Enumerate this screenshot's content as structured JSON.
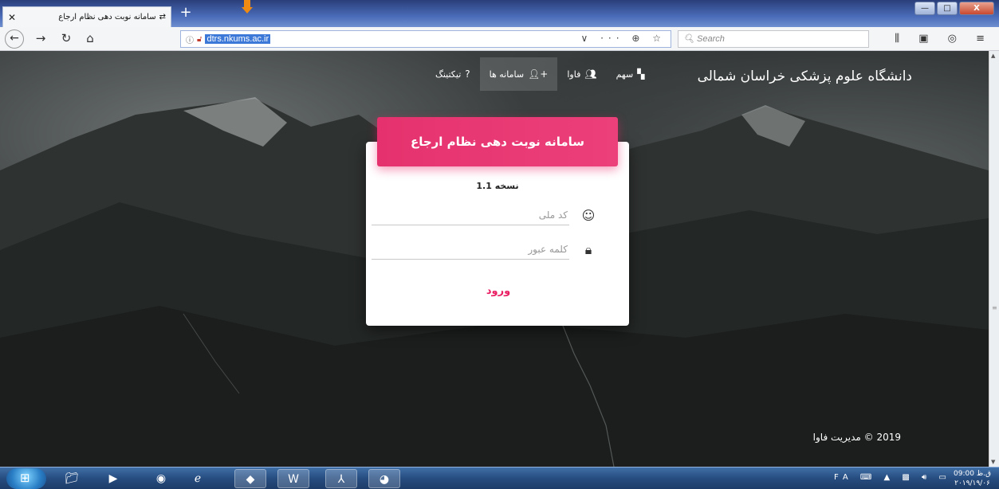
{
  "browser": {
    "tab_title": "سامانه نوبت دهی نظام ارجاع",
    "tab_favicon": "⇄",
    "tab_close": "✕",
    "new_tab": "+",
    "url": "dtrs.nkums.ac.ir",
    "url_info_icon": "ⓘ",
    "url_lock_icon": "🔓︎",
    "url_actions": "∨ ··· ⊕ ☆",
    "search_placeholder": "Search",
    "toolbar_icons": "⫼ ▣ ◎ ≡",
    "window_buttons": {
      "minimize": "—",
      "maximize": "□",
      "close": "X"
    }
  },
  "site": {
    "title": "دانشگاه علوم پزشکی خراسان شمالی",
    "nav": [
      {
        "label": "سهم",
        "icon": "▚"
      },
      {
        "label": "فاوا",
        "icon": "👥︎"
      },
      {
        "label": "سامانه ها",
        "icon": "+👤︎"
      },
      {
        "label": "تیکتینگ",
        "icon": "?"
      }
    ],
    "footer": "2019 © مدیریت فاوا"
  },
  "login": {
    "header": "سامانه نوبت دهی نظام ارجاع",
    "version": "نسخه 1.1",
    "national_code_placeholder": "کد ملی",
    "national_code_icon": "☺",
    "password_placeholder": "کلمه عبور",
    "password_icon": "🔒︎",
    "submit_label": "ورود"
  },
  "taskbar": {
    "apps": [
      "📁︎",
      "▶",
      "◉",
      "ℯ",
      "◆",
      "W",
      "⅄",
      "◕"
    ],
    "tray_lang": "FA",
    "time": "09:00 ق.ظ",
    "date": "۲۰۱۹/۱۹/۰۶"
  },
  "colors": {
    "accent": "#e91e63",
    "header_gradient_start": "#e5326e",
    "header_gradient_end": "#ec407a"
  }
}
